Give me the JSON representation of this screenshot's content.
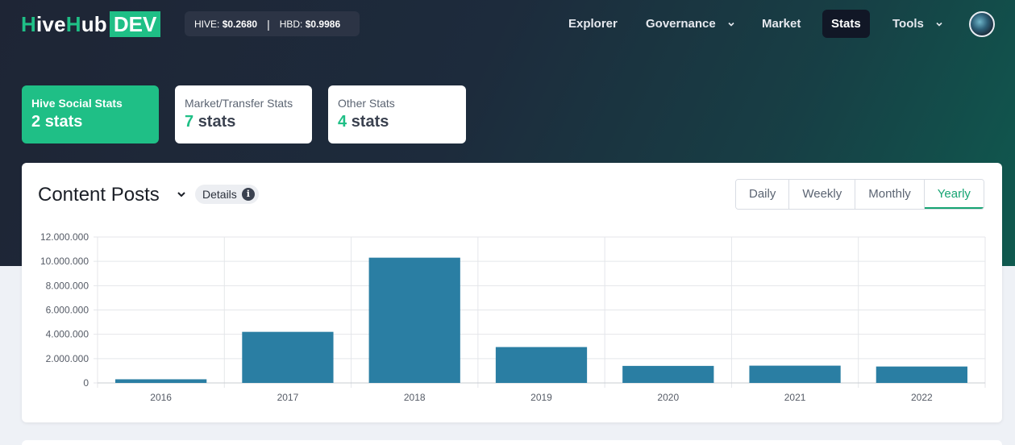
{
  "header": {
    "logo": {
      "part1": "H",
      "part2": "ive",
      "part3": "H",
      "part4": "ub",
      "badge": "DEV"
    },
    "prices": {
      "hive_label": "HIVE:",
      "hive_value": "$0.2680",
      "separator": "|",
      "hbd_label": "HBD:",
      "hbd_value": "$0.9986"
    },
    "nav": {
      "explorer": "Explorer",
      "governance": "Governance",
      "market": "Market",
      "stats": "Stats",
      "tools": "Tools"
    }
  },
  "stat_tabs": [
    {
      "label": "Hive Social Stats",
      "count": "2",
      "suffix": "stats"
    },
    {
      "label": "Market/Transfer Stats",
      "count": "7",
      "suffix": "stats"
    },
    {
      "label": "Other Stats",
      "count": "4",
      "suffix": "stats"
    }
  ],
  "panel": {
    "title": "Content Posts",
    "details_label": "Details",
    "info_glyph": "i",
    "periods": [
      "Daily",
      "Weekly",
      "Monthly",
      "Yearly"
    ],
    "active_period": "Yearly"
  },
  "chart_data": {
    "type": "bar",
    "categories": [
      "2016",
      "2017",
      "2018",
      "2019",
      "2020",
      "2021",
      "2022"
    ],
    "values": [
      300000,
      4200000,
      10300000,
      2950000,
      1400000,
      1420000,
      1350000
    ],
    "ylim": [
      0,
      12000000
    ],
    "y_ticks": [
      "0",
      "2.000.000",
      "4.000.000",
      "6.000.000",
      "8.000.000",
      "10.000.000",
      "12.000.000"
    ],
    "bar_color": "#2a7ea3",
    "grid": true
  },
  "colors": {
    "accent": "#1fbf86",
    "nav_dark": "#111726",
    "bar": "#2a7ea3"
  }
}
